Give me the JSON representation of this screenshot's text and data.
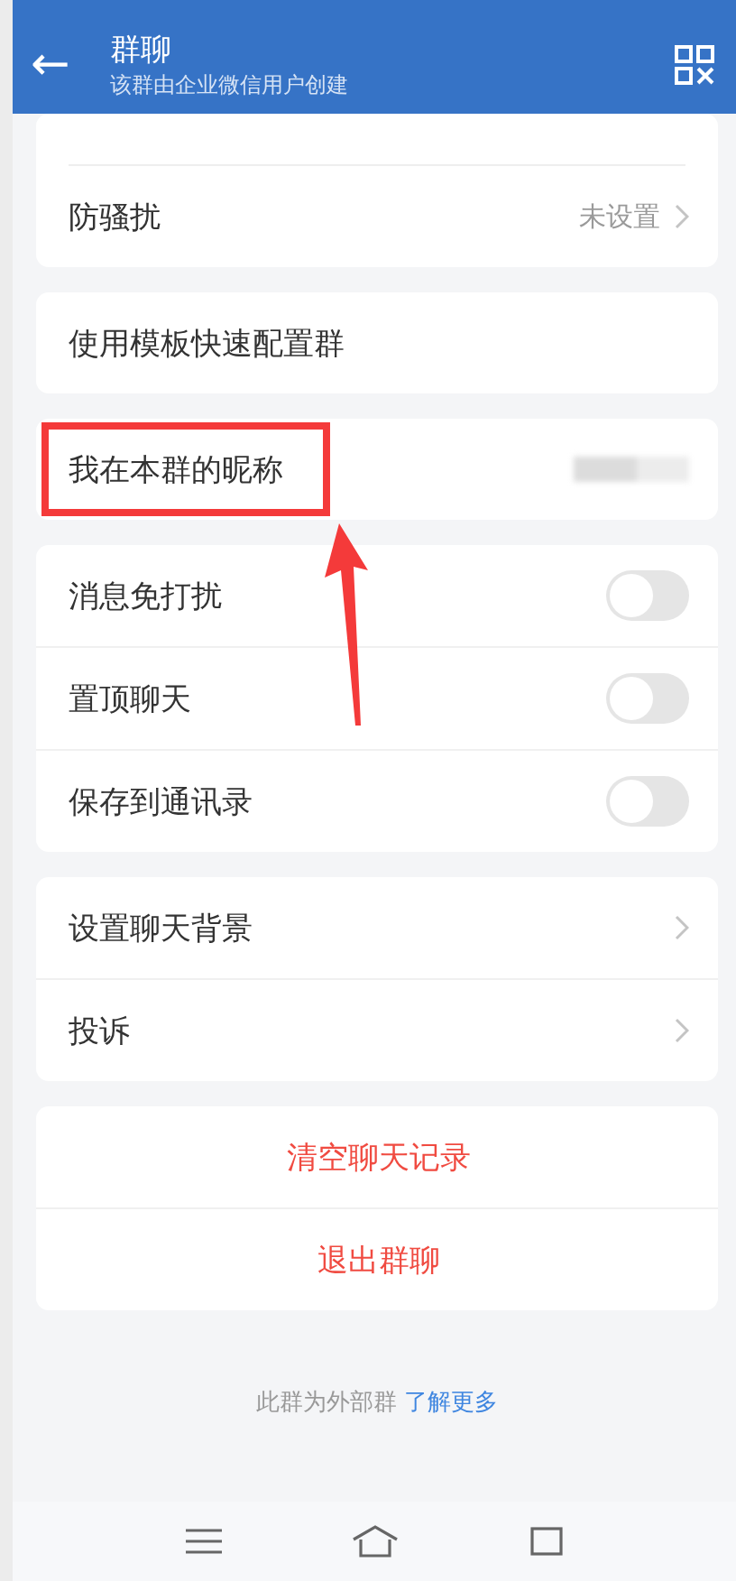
{
  "header": {
    "back": "←",
    "title": "群聊",
    "subtitle": "该群由企业微信用户创建"
  },
  "sections": [
    {
      "rows": [
        {
          "kind": "link",
          "label": "防骚扰",
          "value": "未设置"
        }
      ]
    },
    {
      "rows": [
        {
          "kind": "plain",
          "label": "使用模板快速配置群"
        }
      ]
    },
    {
      "rows": [
        {
          "kind": "nickname",
          "label": "我在本群的昵称",
          "highlighted": true
        }
      ]
    },
    {
      "rows": [
        {
          "kind": "toggle",
          "label": "消息免打扰",
          "on": false
        },
        {
          "kind": "toggle",
          "label": "置顶聊天",
          "on": false
        },
        {
          "kind": "toggle",
          "label": "保存到通讯录",
          "on": false
        }
      ]
    },
    {
      "rows": [
        {
          "kind": "link",
          "label": "设置聊天背景"
        },
        {
          "kind": "link",
          "label": "投诉"
        }
      ]
    },
    {
      "rows": [
        {
          "kind": "danger",
          "label": "清空聊天记录"
        },
        {
          "kind": "danger",
          "label": "退出群聊"
        }
      ]
    }
  ],
  "footer": {
    "text": "此群为外部群",
    "link": "了解更多"
  }
}
